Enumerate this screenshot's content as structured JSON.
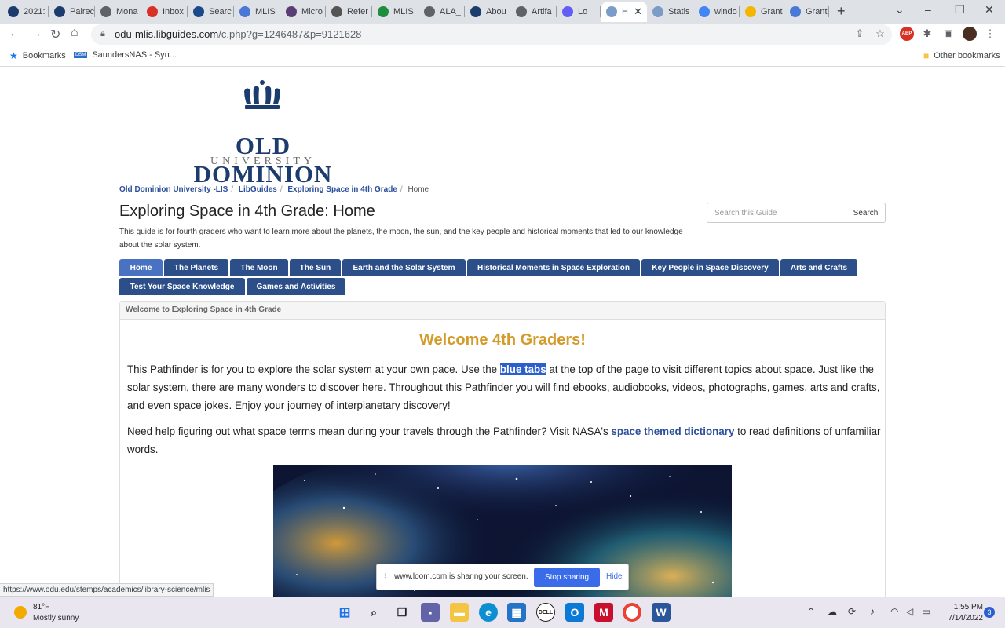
{
  "browser": {
    "tabs": [
      {
        "label": "2021:",
        "icon": "crown-icon",
        "color": "#1d3c6e"
      },
      {
        "label": "Pairec",
        "icon": "crown-icon",
        "color": "#1d3c6e"
      },
      {
        "label": "Mona",
        "icon": "globe-icon",
        "color": "#5f6368"
      },
      {
        "label": "Inbox",
        "icon": "gmail-icon",
        "color": "#d93025"
      },
      {
        "label": "Searc",
        "icon": "globe-icon",
        "color": "#1a4a8a"
      },
      {
        "label": "MLIS",
        "icon": "docs-icon",
        "color": "#4a78d6"
      },
      {
        "label": "Micro",
        "icon": "book-icon",
        "color": "#5a3d72"
      },
      {
        "label": "Refer",
        "icon": "feather-icon",
        "color": "#555555"
      },
      {
        "label": "MLIS",
        "icon": "sheets-icon",
        "color": "#1e8e3e"
      },
      {
        "label": "ALA_",
        "icon": "globe-icon",
        "color": "#5f6368"
      },
      {
        "label": "Abou",
        "icon": "crown-icon",
        "color": "#1d3c6e"
      },
      {
        "label": "Artifa",
        "icon": "globe-icon",
        "color": "#5f6368"
      },
      {
        "label": "Lo",
        "icon": "loom-icon",
        "color": "#625df5"
      },
      {
        "label": "H",
        "icon": "cloud-icon",
        "color": "#7a9cc6"
      },
      {
        "label": "Statis",
        "icon": "cloud-icon",
        "color": "#7a9cc6"
      },
      {
        "label": "windo",
        "icon": "google-icon",
        "color": "#4285f4"
      },
      {
        "label": "Grant",
        "icon": "slides-icon",
        "color": "#f4b400"
      },
      {
        "label": "Grant",
        "icon": "docs-icon",
        "color": "#4a78d6"
      }
    ],
    "new_tab": "+",
    "url_domain": "odu-mlis.libguides.com",
    "url_path": "/c.php?g=1246487&p=9121628",
    "bookmarks": [
      {
        "label": "Bookmarks",
        "icon": "star-icon"
      },
      {
        "label": "SaundersNAS - Syn...",
        "icon": "nas-icon"
      }
    ],
    "other_bookmarks": "Other bookmarks",
    "extension_badge": "ABP"
  },
  "logo": {
    "line1": "OLD DOMINION",
    "line2": "UNIVERSITY"
  },
  "breadcrumb": {
    "items": [
      "Old Dominion University -LIS",
      "LibGuides",
      "Exploring Space in 4th Grade"
    ],
    "current": "Home"
  },
  "guide": {
    "title": "Exploring Space in 4th Grade: Home",
    "description": "This guide is for fourth graders who want to learn more about the planets, the moon, the sun, and the key people and historical moments that led to our knowledge about the solar system."
  },
  "search": {
    "placeholder": "Search this Guide",
    "button": "Search"
  },
  "nav_tabs": [
    "Home",
    "The Planets",
    "The Moon",
    "The Sun",
    "Earth and the Solar System",
    "Historical Moments in Space Exploration",
    "Key People in Space Discovery",
    "Arts and Crafts",
    "Test Your Space Knowledge",
    "Games and Activities"
  ],
  "box": {
    "heading": "Welcome to Exploring Space in 4th Grade",
    "welcome": "Welcome 4th Graders!",
    "p1_before": "This Pathfinder is for you to explore the solar system at your own pace.  Use the ",
    "p1_highlight": "blue tabs",
    "p1_after": " at the top of the page to visit different topics about space.  Just like the solar system, there are many wonders to discover here.  Throughout this Pathfinder you will find ebooks, audiobooks, videos, photographs, games, arts and crafts, and even space jokes.  Enjoy your journey of interplanetary discovery!",
    "p2_before": "Need help figuring out what space terms mean during your travels through the Pathfinder?  Visit NASA's ",
    "p2_link": "space themed dictionary",
    "p2_after": " to read definitions of unfamiliar words."
  },
  "status_url": "https://www.odu.edu/stemps/academics/library-science/mlis",
  "loom": {
    "message": "www.loom.com is sharing your screen.",
    "stop": "Stop sharing",
    "hide": "Hide"
  },
  "taskbar": {
    "temp": "81°F",
    "weather": "Mostly sunny",
    "time": "1:55 PM",
    "date": "7/14/2022",
    "notifications": "3"
  }
}
